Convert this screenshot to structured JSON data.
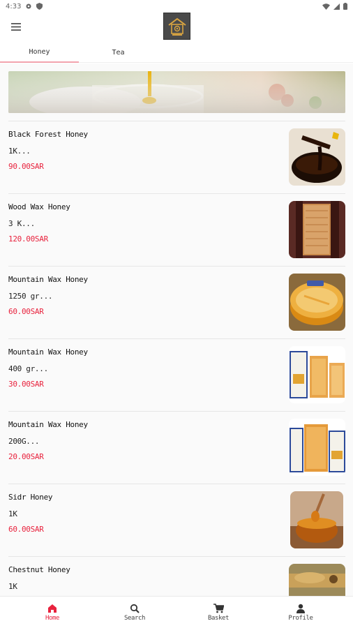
{
  "status": {
    "time": "4:33"
  },
  "tabs": [
    {
      "label": "Honey",
      "active": true
    },
    {
      "label": "Tea",
      "active": false
    }
  ],
  "products": [
    {
      "name": "Black Forest Honey",
      "size": "1K...",
      "price": "90.00SAR",
      "thumb": "dark-honey-spoon"
    },
    {
      "name": "Wood Wax Honey",
      "size": "3 K...",
      "price": "120.00SAR",
      "thumb": "honeycomb-frame"
    },
    {
      "name": "Mountain Wax Honey",
      "size": "1250 gr...",
      "price": "60.00SAR",
      "thumb": "honey-tub"
    },
    {
      "name": "Mountain Wax Honey",
      "size": "400 gr...",
      "price": "30.00SAR",
      "thumb": "boxed-comb"
    },
    {
      "name": "Mountain Wax Honey",
      "size": "200G...",
      "price": "20.00SAR",
      "thumb": "boxed-comb"
    },
    {
      "name": "Sidr Honey",
      "size": "1K",
      "price": "60.00SAR",
      "thumb": "honey-bowl-dipper"
    },
    {
      "name": "Chestnut Honey",
      "size": "1K",
      "price": "",
      "thumb": "chestnut-jar"
    }
  ],
  "nav": [
    {
      "label": "Home",
      "icon": "home-icon",
      "active": true
    },
    {
      "label": "Search",
      "icon": "search-icon",
      "active": false
    },
    {
      "label": "Basket",
      "icon": "cart-icon",
      "active": false
    },
    {
      "label": "Profile",
      "icon": "person-icon",
      "active": false
    }
  ],
  "colors": {
    "accent": "#e8233e",
    "tab_underline": "#f2a3ad"
  }
}
